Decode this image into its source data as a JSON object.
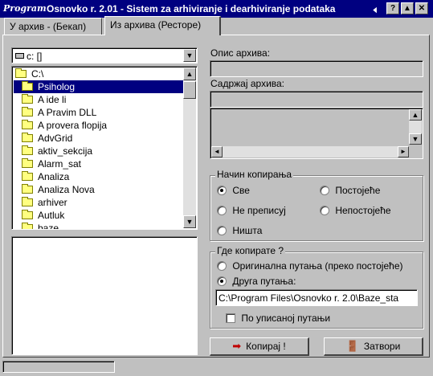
{
  "window": {
    "app_logo": "Program",
    "title": "Osnovko r. 2.01 - Sistem za arhiviranje i dearhiviranje podataka",
    "controls": {
      "help_glyph": "?",
      "minimize_glyph": "▲",
      "close_glyph": "✕"
    }
  },
  "tabs": [
    {
      "label": "У архив - (Бекап)"
    },
    {
      "label": "Из архива (Ресторе)"
    }
  ],
  "drive": {
    "value": "c: []",
    "arrow_glyph": "▼"
  },
  "directories": {
    "root": "C:\\",
    "selected": "Psiholog",
    "items": [
      "A ide li",
      "A Pravim DLL",
      "A provera flopija",
      "AdvGrid",
      "aktiv_sekcija",
      "Alarm_sat",
      "Analiza",
      "Analiza Nova",
      "arhiver",
      "Autluk",
      "baze"
    ],
    "scroll_up_glyph": "▲",
    "scroll_down_glyph": "▼"
  },
  "archive": {
    "description_label": "Опис архива:",
    "description_value": "",
    "contents_label": "Садржај архива:",
    "contents_value": "",
    "scroll_up_glyph": "▲",
    "scroll_down_glyph": "▼",
    "scroll_left_glyph": "◄",
    "scroll_right_glyph": "►"
  },
  "copy_mode": {
    "title": "Начин копирања",
    "options": [
      {
        "label": "Све",
        "selected": true
      },
      {
        "label": "Постојеће",
        "selected": false
      },
      {
        "label": "Не преписуј",
        "selected": false
      },
      {
        "label": "Непостојеће",
        "selected": false
      },
      {
        "label": "Ништа",
        "selected": false
      }
    ]
  },
  "destination": {
    "title": "Где копирате ?",
    "original_path_label": "Оригинална путања (преко постојеће)",
    "other_path_label": "Друга путања:",
    "selected": "other",
    "path_value": "C:\\Program Files\\Osnovko r. 2.0\\Baze_sta",
    "use_entered_path_label": "По уписаној путањи",
    "use_entered_path_checked": false
  },
  "buttons": {
    "copy_label": "Копирај !",
    "close_label": "Затвори"
  }
}
